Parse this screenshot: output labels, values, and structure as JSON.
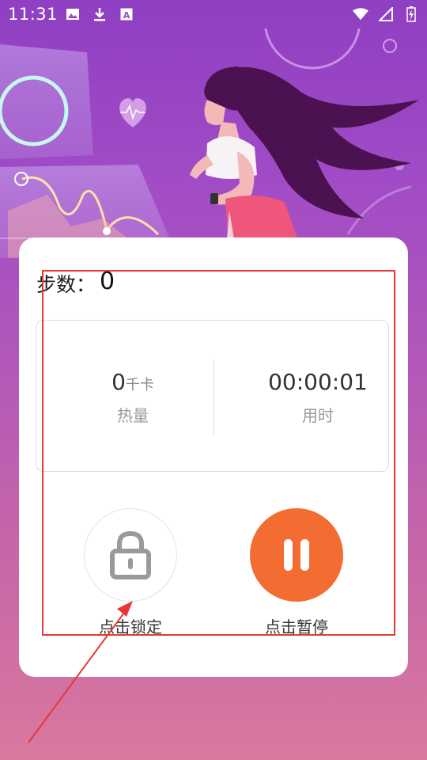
{
  "status_bar": {
    "time": "11:31",
    "left_icons": [
      "image-icon",
      "download-icon",
      "font-icon"
    ],
    "right_icons": [
      "wifi-icon",
      "signal-icon",
      "battery-icon"
    ]
  },
  "card": {
    "steps_label": "步数：",
    "steps_value": "0",
    "calories": {
      "value": "0",
      "unit": "千卡",
      "label": "热量"
    },
    "duration": {
      "value": "00:00:01",
      "label": "用时"
    },
    "lock_button": {
      "label": "点击锁定",
      "icon": "lock-icon"
    },
    "pause_button": {
      "label": "点击暂停",
      "icon": "pause-icon"
    }
  },
  "colors": {
    "accent": "#f36d32",
    "annotation": "#e53935",
    "background_top": "#8f3fc2",
    "background_bottom": "#d9789f"
  }
}
